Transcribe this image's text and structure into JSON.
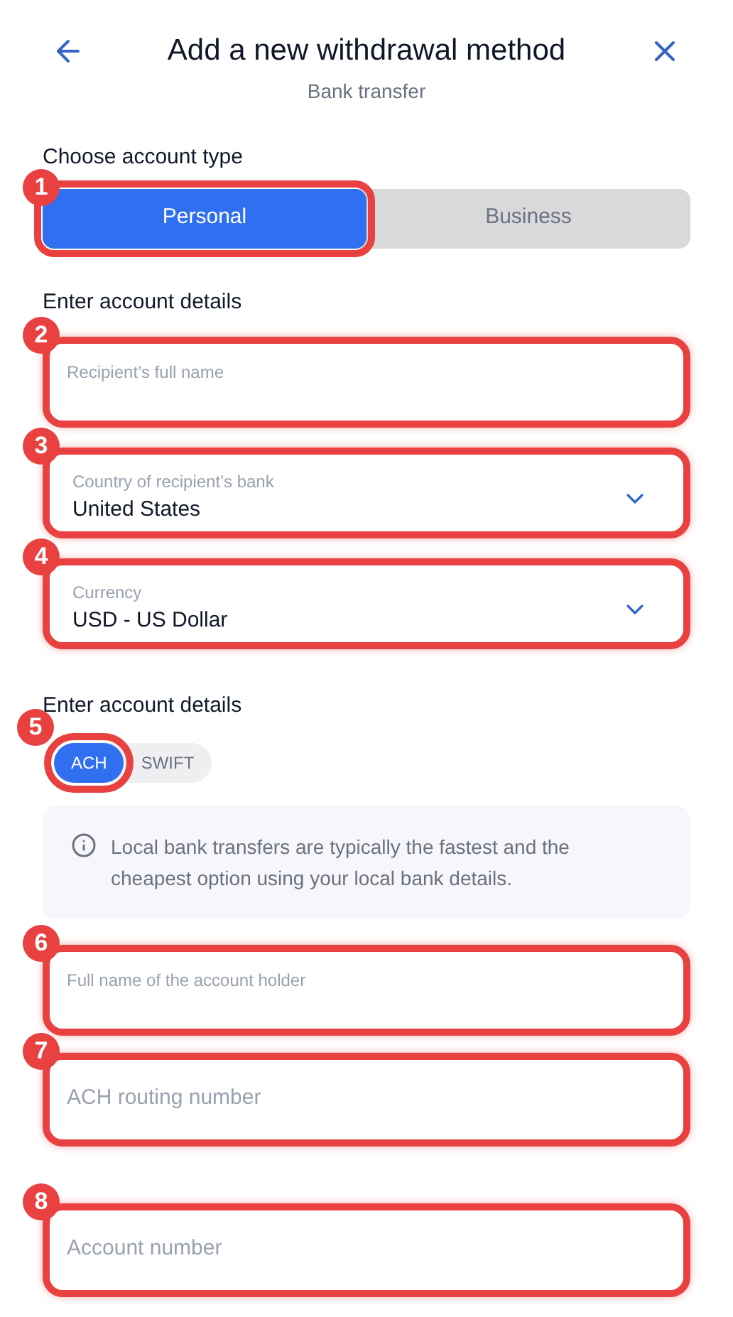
{
  "header": {
    "title": "Add a new withdrawal method",
    "subtitle": "Bank transfer"
  },
  "account_type": {
    "label": "Choose account type",
    "options": [
      {
        "label": "Personal",
        "selected": true,
        "badge": "1"
      },
      {
        "label": "Business",
        "selected": false
      }
    ]
  },
  "details": {
    "label": "Enter account details",
    "fields": [
      {
        "kind": "text",
        "label": "Recipient’s full name",
        "badge": "2"
      },
      {
        "kind": "select",
        "label": "Country of recipient’s bank",
        "value": "United States",
        "badge": "3"
      },
      {
        "kind": "select",
        "label": "Currency",
        "value": "USD - US Dollar",
        "badge": "4"
      }
    ]
  },
  "transfer": {
    "label": "Enter account details",
    "options": [
      {
        "label": "ACH",
        "selected": true,
        "badge": "5"
      },
      {
        "label": "SWIFT",
        "selected": false
      }
    ],
    "info": "Local bank transfers are typically the fastest and the cheapest option using your local bank details.",
    "fields": [
      {
        "kind": "text",
        "label": "Full name of the account holder",
        "badge": "6"
      },
      {
        "kind": "placeholder",
        "placeholder": "ACH routing number",
        "badge": "7"
      },
      {
        "kind": "placeholder",
        "placeholder": "Account number",
        "badge": "8"
      }
    ]
  }
}
